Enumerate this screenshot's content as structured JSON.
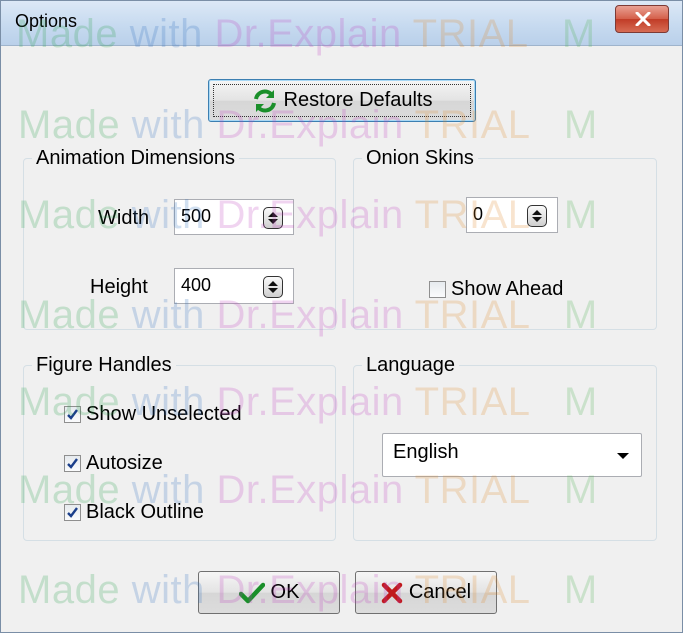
{
  "window": {
    "title": "Options",
    "close_icon": "close-icon"
  },
  "buttons": {
    "restore_label": "Restore Defaults",
    "restore_icon": "refresh-icon",
    "ok_label": "OK",
    "ok_icon": "checkmark-icon",
    "cancel_label": "Cancel",
    "cancel_icon": "x-icon"
  },
  "animation_dimensions": {
    "title": "Animation Dimensions",
    "width_label": "Width",
    "width_value": "500",
    "height_label": "Height",
    "height_value": "400"
  },
  "onion_skins": {
    "title": "Onion Skins",
    "value": "0",
    "show_ahead_label": "Show Ahead",
    "show_ahead_checked": false
  },
  "figure_handles": {
    "title": "Figure Handles",
    "items": [
      {
        "label": "Show Unselected",
        "checked": true
      },
      {
        "label": "Autosize",
        "checked": true
      },
      {
        "label": "Black Outline",
        "checked": true
      }
    ]
  },
  "language": {
    "title": "Language",
    "selected": "English"
  },
  "watermark": {
    "made": "Made",
    "with": "with",
    "dr": "Dr.Explain",
    "trial": "TRIAL",
    "tail": "M"
  }
}
